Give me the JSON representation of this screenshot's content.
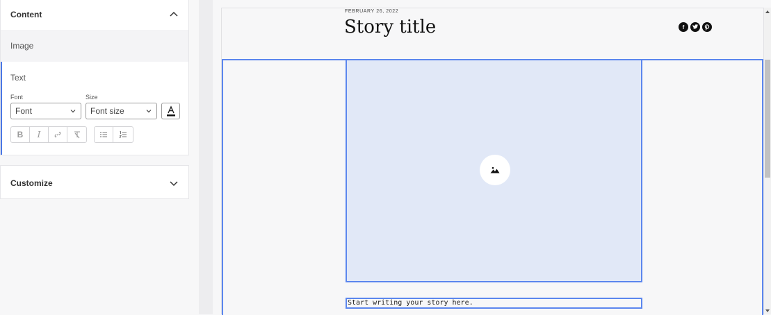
{
  "sidebar": {
    "content_section": {
      "title": "Content",
      "items": {
        "image": "Image",
        "text": "Text"
      }
    },
    "text_editor": {
      "font_label": "Font",
      "size_label": "Size",
      "font_select_value": "Font",
      "size_select_value": "Font size",
      "format_buttons": [
        "bold-icon",
        "italic-icon",
        "link-icon",
        "clear-format-icon",
        "bullet-list-icon",
        "numbered-list-icon"
      ]
    },
    "customize_section": {
      "title": "Customize"
    }
  },
  "preview": {
    "date": "FEBRUARY 26, 2022",
    "title": "Story title",
    "social_icons": [
      "facebook-icon",
      "twitter-icon",
      "pinterest-icon"
    ],
    "image_placeholder_icon": "image-icon",
    "story_placeholder": "Start writing your story here."
  },
  "colors": {
    "accent": "#5b86ee",
    "image_fill": "#e1e8f7",
    "active_bar": "#4a77e5"
  }
}
